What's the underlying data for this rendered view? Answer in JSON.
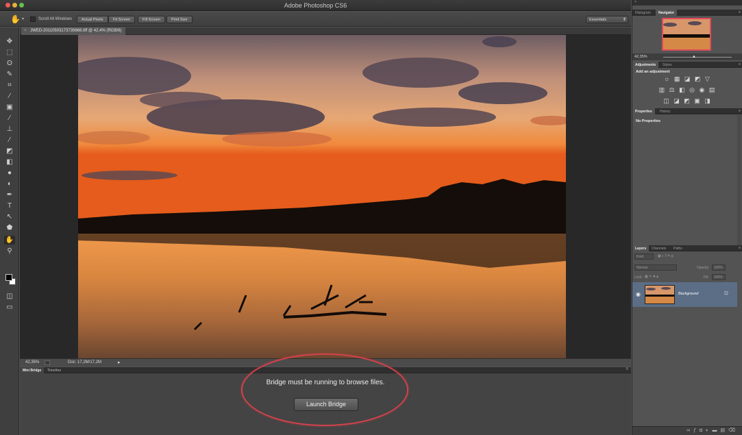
{
  "window": {
    "title": "Adobe Photoshop CS6"
  },
  "options_bar": {
    "tool_icon": "hand-icon",
    "scroll_all_windows": "Scroll All Windows",
    "buttons": [
      "Actual Pixels",
      "Fit Screen",
      "Fill Screen",
      "Print Size"
    ],
    "workspace": "Essentials"
  },
  "tools": [
    "move-icon",
    "marquee-icon",
    "lasso-icon",
    "quick-selection-icon",
    "crop-icon",
    "eyedropper-icon",
    "spot-healing-icon",
    "brush-icon",
    "clone-stamp-icon",
    "history-brush-icon",
    "eraser-icon",
    "gradient-icon",
    "blur-icon",
    "dodge-icon",
    "pen-icon",
    "type-icon",
    "path-selection-icon",
    "shape-icon",
    "hand-icon",
    "zoom-icon"
  ],
  "document": {
    "tab_title": "JWED-20110503173739866.tiff @ 42,4% (RGB/8)",
    "zoom": "42,35%",
    "doc_size": "Doc: 17,2M/17,2M"
  },
  "mini_bridge": {
    "tabs": [
      "Mini Bridge",
      "Timeline"
    ],
    "message": "Bridge must be running to browse files.",
    "launch_button": "Launch Bridge"
  },
  "panels": {
    "navigator": {
      "tabs": [
        "Histogram",
        "Navigator"
      ],
      "zoom": "42,35%"
    },
    "adjustments": {
      "tabs": [
        "Adjustments",
        "Styles"
      ],
      "title": "Add an adjustment"
    },
    "properties": {
      "tabs": [
        "Properties",
        "History"
      ],
      "body": "No Properties"
    },
    "layers": {
      "tabs": [
        "Layers",
        "Channels",
        "Paths"
      ],
      "filter_kind": "Kind",
      "blend_mode": "Normal",
      "opacity_label": "Opacity:",
      "opacity_value": "100%",
      "lock_label": "Lock:",
      "fill_label": "Fill:",
      "fill_value": "100%",
      "layer_name": "Background"
    }
  }
}
